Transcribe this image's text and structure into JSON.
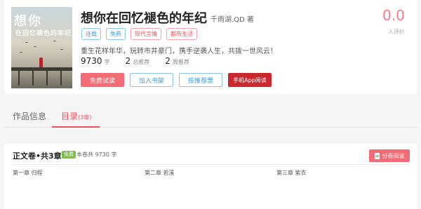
{
  "book": {
    "title": "想你在回忆褪色的年纪",
    "author": "千雨湖.QD 著",
    "rating": "0.0",
    "rating_label": "人评价",
    "cover_title": "想你",
    "cover_subtitle": "在回忆褪色的年纪",
    "tags": [
      {
        "label": "连载",
        "color": "blue"
      },
      {
        "label": "免费",
        "color": "blue"
      },
      {
        "label": "现代言情",
        "color": "red"
      },
      {
        "label": "都市生活",
        "color": "red"
      }
    ],
    "description": "重生花样年华，玩转市井豪门，携手逆袭人生，共拨一世风云！",
    "stats": [
      {
        "value": "9730",
        "unit": "字"
      },
      {
        "value": "2",
        "unit": "总推荐"
      },
      {
        "value": "2",
        "unit": "周推荐"
      }
    ],
    "buttons": {
      "free_read": "免费试读",
      "add_shelf": "加入书架",
      "vote": "投推荐票",
      "app_read": "手机App阅读"
    }
  },
  "tabs": {
    "info": "作品信息",
    "catalog": "目录",
    "catalog_count": "(3章)"
  },
  "volume": {
    "title": "正文卷•共3章",
    "badge": "免费",
    "word_count": "本卷共 9730 字",
    "read_button": "分卷阅读"
  },
  "chapters": [
    "第一章  归程",
    "第二章  若溪",
    "第三章  紫衣"
  ],
  "colors": {
    "accent_red": "#f36b74",
    "accent_blue": "#3f9be0",
    "free_green": "#7ac143"
  }
}
